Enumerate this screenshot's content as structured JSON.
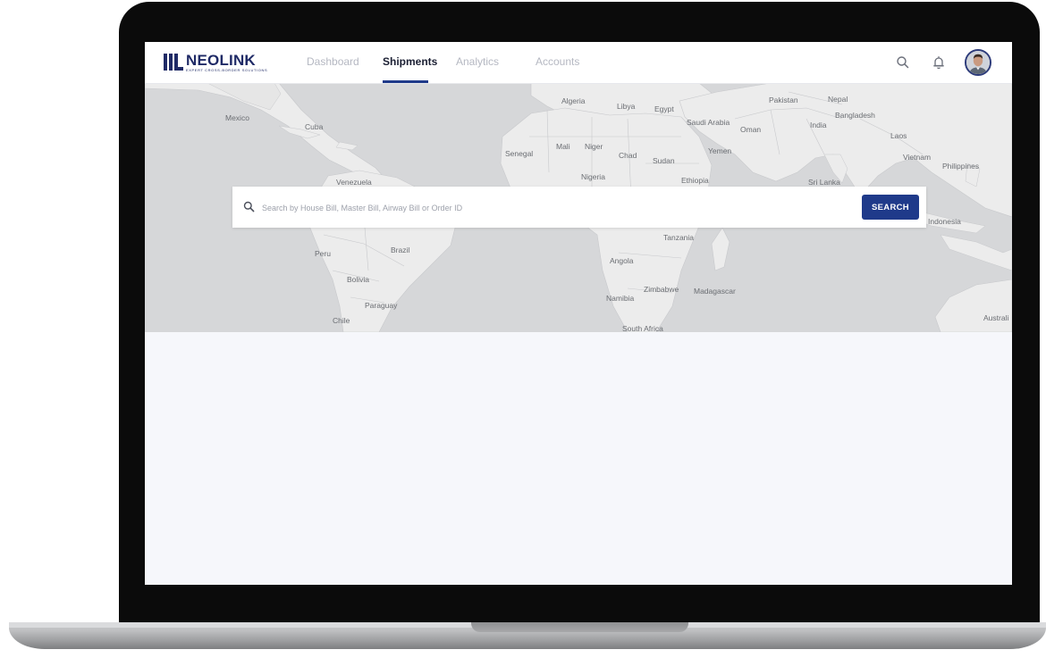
{
  "brand": {
    "name": "NEOLINK",
    "tagline": "EXPERT CROSS-BORDER SOLUTIONS"
  },
  "nav": {
    "tabs": [
      {
        "label": "Dashboard"
      },
      {
        "label": "Shipments"
      },
      {
        "label": "Analytics"
      },
      {
        "label": "Accounts"
      }
    ],
    "active_tab": "Shipments"
  },
  "header_icons": [
    "search-icon",
    "bell-icon",
    "user-avatar"
  ],
  "search": {
    "placeholder": "Search by House Bill, Master Bill, Airway Bill or Order ID",
    "value": "",
    "button_label": "SEARCH"
  },
  "map_labels": {
    "mexico": "Mexico",
    "cuba": "Cuba",
    "venezuela": "Venezuela",
    "peru": "Peru",
    "brazil": "Brazil",
    "bolivia": "Bolivia",
    "paraguay": "Paraguay",
    "chile": "Chile",
    "algeria": "Algeria",
    "libya": "Libya",
    "egypt": "Egypt",
    "saudi_arabia": "Saudi Arabia",
    "oman": "Oman",
    "yemen": "Yemen",
    "senegal": "Senegal",
    "mali": "Mali",
    "niger": "Niger",
    "chad": "Chad",
    "sudan": "Sudan",
    "nigeria": "Nigeria",
    "ethiopia": "Ethiopia",
    "tanzania": "Tanzania",
    "angola": "Angola",
    "zimbabwe": "Zimbabwe",
    "madagascar": "Madagascar",
    "namibia": "Namibia",
    "south_africa": "South Africa",
    "pakistan": "Pakistan",
    "nepal": "Nepal",
    "bangladesh": "Bangladesh",
    "india": "India",
    "sri_lanka": "Sri Lanka",
    "laos": "Laos",
    "vietnam": "Vietnam",
    "philippines": "Philippines",
    "indonesia": "Indonesia",
    "australia": "Australi"
  },
  "colors": {
    "brand_navy": "#1f2a66",
    "accent_blue": "#1f3a8a",
    "map_water": "#d6d7d9",
    "map_land": "#ececec",
    "content_bg": "#f6f7fb"
  }
}
